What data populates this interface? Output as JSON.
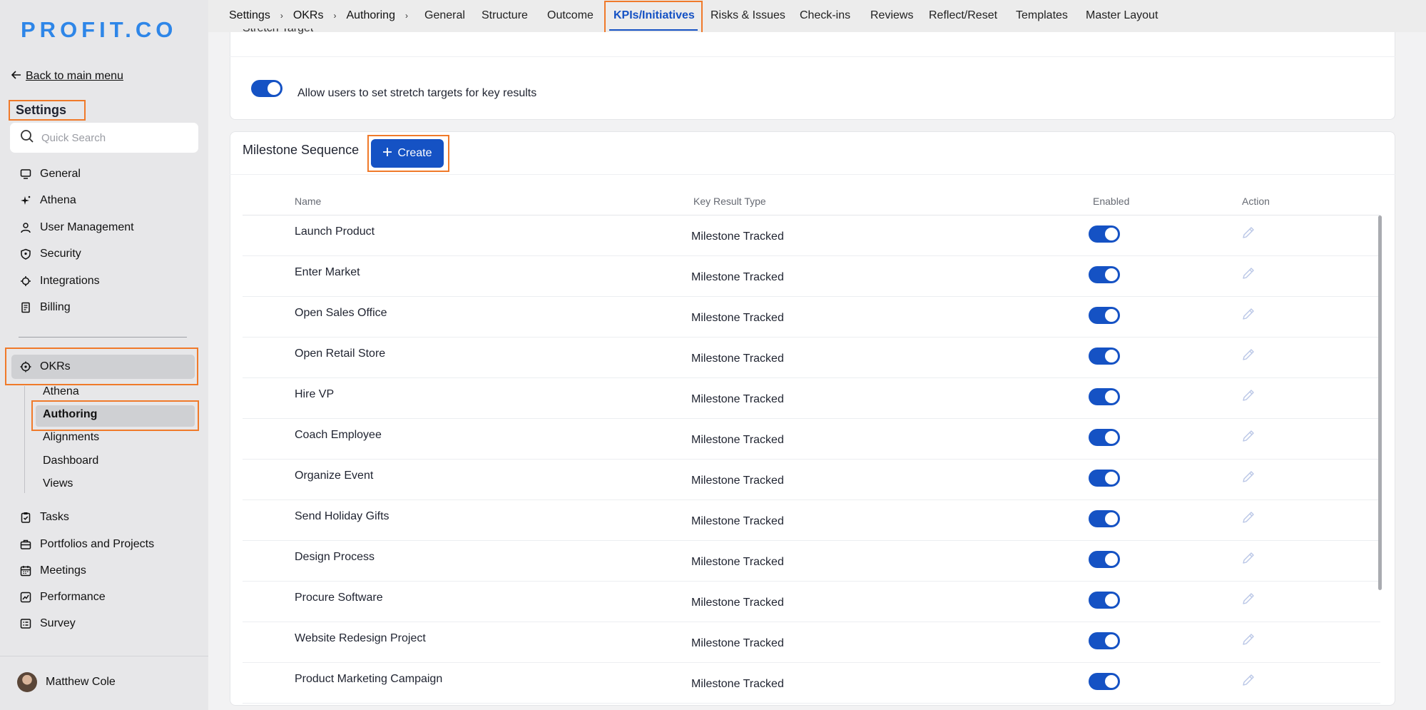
{
  "logo": "PROFIT.CO",
  "sidebar": {
    "back_label": "Back to main menu",
    "title": "Settings",
    "search_placeholder": "Quick Search",
    "items": [
      {
        "label": "General",
        "icon": "monitor-icon"
      },
      {
        "label": "Athena",
        "icon": "sparkle-icon"
      },
      {
        "label": "User Management",
        "icon": "user-icon"
      },
      {
        "label": "Security",
        "icon": "shield-icon"
      },
      {
        "label": "Integrations",
        "icon": "plug-icon"
      },
      {
        "label": "Billing",
        "icon": "receipt-icon"
      }
    ],
    "okrs": {
      "label": "OKRs",
      "icon": "target-icon"
    },
    "okr_sub": [
      "Athena",
      "Authoring",
      "Alignments",
      "Dashboard",
      "Views"
    ],
    "items2": [
      {
        "label": "Tasks",
        "icon": "clipboard-check-icon"
      },
      {
        "label": "Portfolios and Projects",
        "icon": "briefcase-icon"
      },
      {
        "label": "Meetings",
        "icon": "calendar-icon"
      },
      {
        "label": "Performance",
        "icon": "chart-icon"
      },
      {
        "label": "Survey",
        "icon": "survey-icon"
      }
    ],
    "user": "Matthew Cole"
  },
  "breadcrumb": [
    "Settings",
    "OKRs",
    "Authoring"
  ],
  "tabs": [
    "General",
    "Structure",
    "Outcome",
    "KPIs/Initiatives",
    "Risks & Issues",
    "Check-ins",
    "Reviews",
    "Reflect/Reset",
    "Templates",
    "Master Layout"
  ],
  "active_tab": "KPIs/Initiatives",
  "stretch": {
    "heading": "Stretch Target",
    "label": "Allow users to set stretch targets for key results"
  },
  "milestone": {
    "title": "Milestone Sequence",
    "create_label": "Create",
    "columns": [
      "Name",
      "Key Result Type",
      "Enabled",
      "Action"
    ],
    "rows": [
      {
        "name": "Launch Product",
        "type": "Milestone Tracked",
        "enabled": true
      },
      {
        "name": "Enter Market",
        "type": "Milestone Tracked",
        "enabled": true
      },
      {
        "name": "Open Sales Office",
        "type": "Milestone Tracked",
        "enabled": true
      },
      {
        "name": "Open Retail Store",
        "type": "Milestone Tracked",
        "enabled": true
      },
      {
        "name": "Hire VP",
        "type": "Milestone Tracked",
        "enabled": true
      },
      {
        "name": "Coach Employee",
        "type": "Milestone Tracked",
        "enabled": true
      },
      {
        "name": "Organize Event",
        "type": "Milestone Tracked",
        "enabled": true
      },
      {
        "name": "Send Holiday Gifts",
        "type": "Milestone Tracked",
        "enabled": true
      },
      {
        "name": "Design Process",
        "type": "Milestone Tracked",
        "enabled": true
      },
      {
        "name": "Procure Software",
        "type": "Milestone Tracked",
        "enabled": true
      },
      {
        "name": "Website Redesign Project",
        "type": "Milestone Tracked",
        "enabled": true
      },
      {
        "name": "Product Marketing Campaign",
        "type": "Milestone Tracked",
        "enabled": true
      }
    ]
  },
  "colors": {
    "accent": "#1552c4",
    "highlight": "#f07a2a",
    "logo": "#2e86e8"
  }
}
